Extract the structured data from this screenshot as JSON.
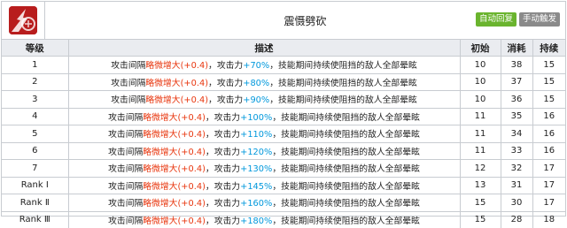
{
  "skill": {
    "name": "震慑劈砍",
    "badges": [
      {
        "label": "自动回复",
        "color": "#6ab42e"
      },
      {
        "label": "手动触发",
        "color": "#8a8a8a"
      }
    ]
  },
  "table": {
    "headers": [
      "等级",
      "描述",
      "初始",
      "消耗",
      "持续"
    ],
    "desc_parts": {
      "p1": "攻击间隔",
      "p2": "略微增大",
      "p3": "(+0.4)",
      "p4": "，攻击力",
      "p6": "，技能期间持续使阻挡的敌人全部晕眩"
    },
    "rows": [
      {
        "level": "1",
        "atk": "+70%",
        "initial": "10",
        "cost": "38",
        "duration": "15"
      },
      {
        "level": "2",
        "atk": "+80%",
        "initial": "10",
        "cost": "37",
        "duration": "15"
      },
      {
        "level": "3",
        "atk": "+90%",
        "initial": "10",
        "cost": "36",
        "duration": "15"
      },
      {
        "level": "4",
        "atk": "+100%",
        "initial": "11",
        "cost": "35",
        "duration": "16"
      },
      {
        "level": "5",
        "atk": "+110%",
        "initial": "11",
        "cost": "34",
        "duration": "16"
      },
      {
        "level": "6",
        "atk": "+120%",
        "initial": "11",
        "cost": "33",
        "duration": "16"
      },
      {
        "level": "7",
        "atk": "+130%",
        "initial": "12",
        "cost": "32",
        "duration": "17"
      },
      {
        "level": "Rank Ⅰ",
        "atk": "+145%",
        "initial": "13",
        "cost": "31",
        "duration": "17"
      },
      {
        "level": "Rank Ⅱ",
        "atk": "+160%",
        "initial": "15",
        "cost": "30",
        "duration": "17"
      },
      {
        "level": "Rank Ⅲ",
        "atk": "+180%",
        "initial": "15",
        "cost": "28",
        "duration": "18"
      }
    ]
  }
}
